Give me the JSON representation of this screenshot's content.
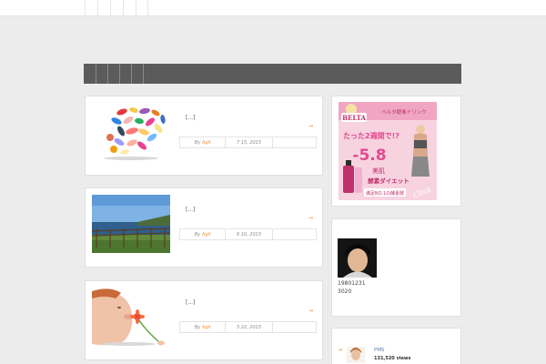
{
  "header": {
    "nav_cells": [
      "",
      "",
      "",
      "",
      ""
    ]
  },
  "menubar": {
    "menu_cells": [
      "",
      "",
      "",
      "",
      ""
    ]
  },
  "posts": [
    {
      "excerpt": "[...]",
      "more_icon": "arrow-right-icon",
      "more": "→",
      "by_label": "By",
      "author": "fujii",
      "date": "7 15, 2015",
      "thumb": "pills-image"
    },
    {
      "excerpt": "[...]",
      "more_icon": "arrow-right-icon",
      "more": "→",
      "by_label": "By",
      "author": "fujii",
      "date": "6 10, 2015",
      "thumb": "seaside-image"
    },
    {
      "excerpt": "[...]",
      "more_icon": "arrow-right-icon",
      "more": "→",
      "by_label": "By",
      "author": "fujii",
      "date": "5 22, 2015",
      "thumb": "flower-image"
    }
  ],
  "sidebar": {
    "ad": {
      "brand": "BELTA",
      "tagline": "ベルタ酵素ドリンク",
      "headline": "たった2週間で!?",
      "big_text": "-5.8",
      "sub1": "美肌",
      "sub2": "酵素ダイエット",
      "sub3": "満足NO.1の酵素飲",
      "cta": "Click"
    },
    "profile": {
      "line1": "19801231",
      "line2": "3020"
    },
    "popular": {
      "arrow": "→",
      "title": "PMS",
      "views": "131,520 views"
    }
  },
  "colors": {
    "accent": "#e8892b",
    "menubar": "#5b5b5b",
    "background": "#ececec"
  }
}
